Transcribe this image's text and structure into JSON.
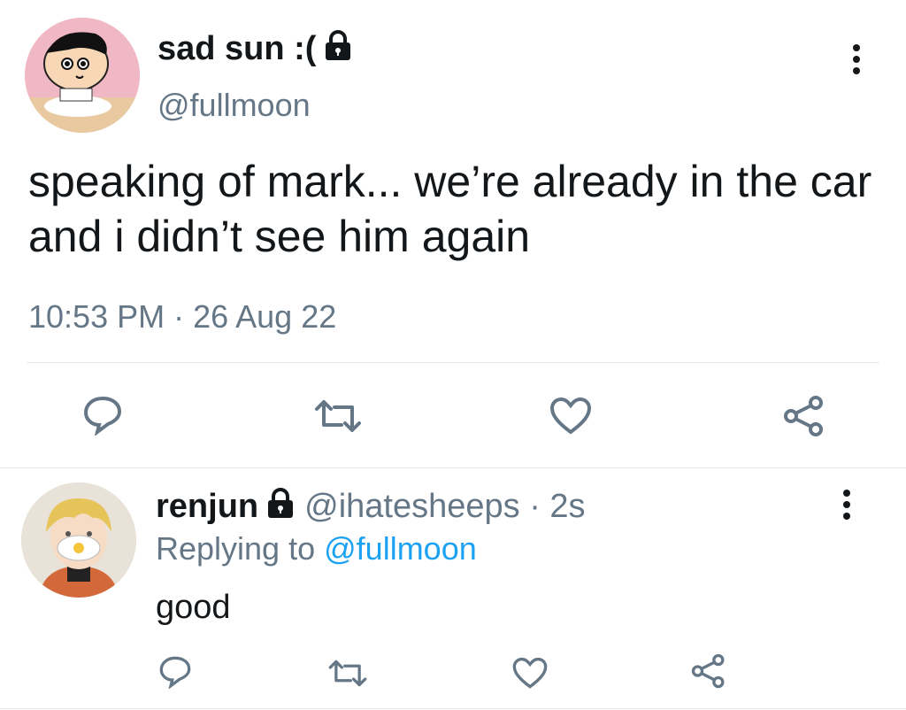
{
  "tweet": {
    "display_name": "sad sun :(",
    "handle": "@fullmoon",
    "text": "speaking of mark... we’re already in the car and i didn’t see him again",
    "timestamp": "10:53 PM · 26 Aug 22",
    "icons": [
      "lock-icon",
      "more-icon",
      "reply-icon",
      "retweet-icon",
      "like-icon",
      "share-icon"
    ]
  },
  "reply": {
    "display_name": "renjun",
    "handle": "@ihatesheeps · 2s",
    "replying_prefix": "Replying to",
    "replying_to": "@fullmoon",
    "text": "good",
    "icons": [
      "lock-icon",
      "more-icon",
      "reply-icon",
      "retweet-icon",
      "like-icon",
      "share-icon"
    ]
  },
  "colors": {
    "text": "#14171a",
    "secondary": "#657786",
    "link": "#1da1f2",
    "divider": "#e1e8ed"
  }
}
